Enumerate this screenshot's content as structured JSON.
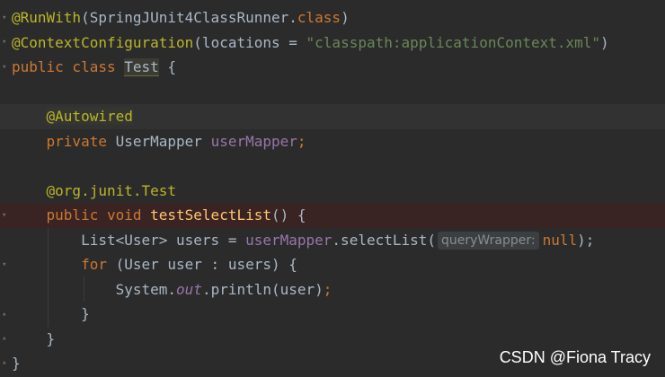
{
  "editor": {
    "lines": [
      {
        "id": 1,
        "t_ann": "@RunWith",
        "t_paren": "(SpringJUnit4ClassRunner.",
        "t_kw": "class",
        "t_end": ")"
      },
      {
        "id": 2,
        "t_ann": "@ContextConfiguration",
        "t_open": "(locations = ",
        "t_str": "\"classpath:applicationContext.xml\"",
        "t_end": ")"
      },
      {
        "id": 3,
        "t_kw": "public class ",
        "t_cls": "Test",
        "t_end": " {"
      },
      {
        "id": 5,
        "t_ann": "@Autowired"
      },
      {
        "id": 6,
        "t_kw": "private ",
        "t_type": "UserMapper ",
        "t_fld": "userMapper",
        "t_end": ";"
      },
      {
        "id": 8,
        "t_ann1": "@org.junit.",
        "t_ann2": "Test"
      },
      {
        "id": 9,
        "t_kw": "public void ",
        "t_fn": "testSelectList",
        "t_end": "() {"
      },
      {
        "id": 10,
        "t_type": "List<User> users = ",
        "t_fld": "userMapper",
        "t_mid": ".selectList(",
        "t_hint": "queryWrapper:",
        "t_kw": "null",
        "t_end": ");"
      },
      {
        "id": 11,
        "t_kw": "for ",
        "t_end": "(User user : users) {"
      },
      {
        "id": 12,
        "t_a": "System.",
        "t_it": "out",
        "t_b": ".println(user)",
        "t_kw": ";"
      },
      {
        "id": 13,
        "t_end": "}"
      },
      {
        "id": 14,
        "t_end": "}"
      },
      {
        "id": 15,
        "t_end": "}"
      }
    ]
  },
  "watermark": "CSDN @Fiona Tracy",
  "colors": {
    "background": "#2b2b2b",
    "annotation": "#bbb529",
    "keyword": "#cc7832",
    "string": "#6a8759",
    "field": "#9876aa",
    "method": "#ffc66d",
    "text": "#a9b7c6"
  }
}
